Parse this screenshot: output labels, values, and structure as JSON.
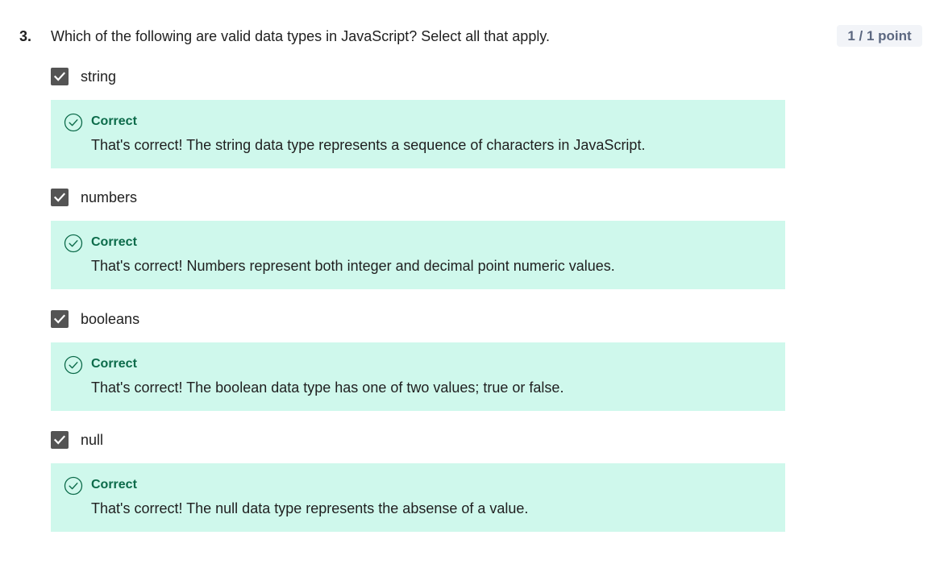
{
  "question": {
    "number": "3.",
    "text": "Which of the following are valid data types in JavaScript? Select all that apply.",
    "points": "1 / 1 point"
  },
  "options": [
    {
      "label": "string",
      "checked": true,
      "feedback_title": "Correct",
      "feedback_text": "That's correct! The string data type represents a sequence of characters in JavaScript."
    },
    {
      "label": "numbers",
      "checked": true,
      "feedback_title": "Correct",
      "feedback_text": "That's correct! Numbers represent both integer and decimal point numeric values."
    },
    {
      "label": "booleans",
      "checked": true,
      "feedback_title": "Correct",
      "feedback_text": "That's correct! The boolean data type has one of two values; true or false."
    },
    {
      "label": "null",
      "checked": true,
      "feedback_title": "Correct",
      "feedback_text": "That's correct! The null data type represents the absense of a value."
    }
  ],
  "icons": {
    "checkbox": "checkmark-icon",
    "feedback": "check-circle-icon"
  },
  "colors": {
    "checkbox_fill": "#545454",
    "feedback_background": "#cff8ec",
    "feedback_accent": "#0c6b4a",
    "points_badge_background": "#f2f4f8",
    "points_badge_text": "#5b6780"
  }
}
